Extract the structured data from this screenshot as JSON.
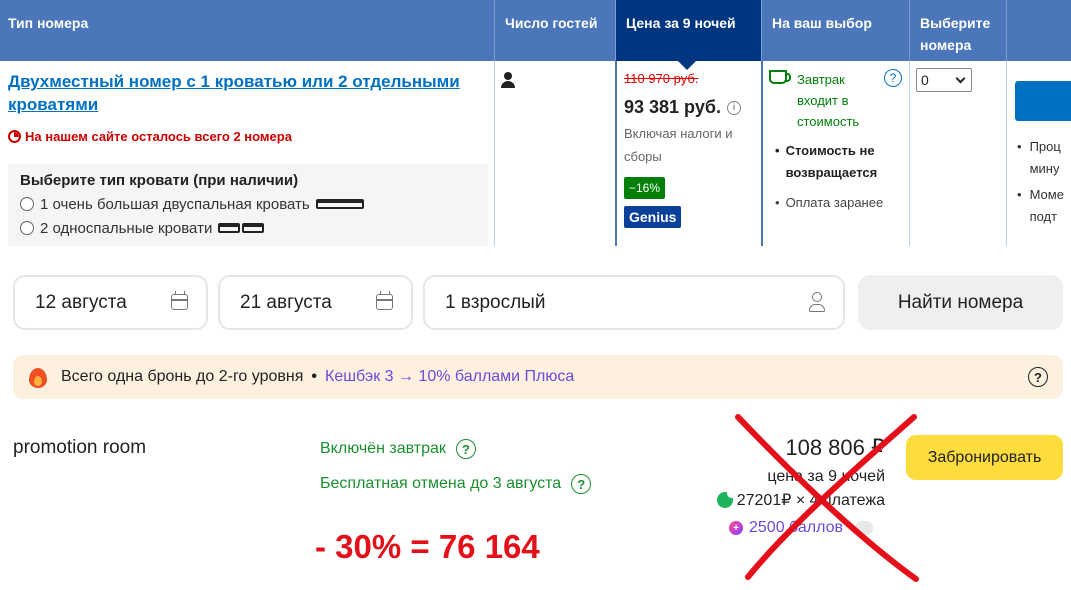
{
  "table": {
    "headers": {
      "room_type": "Тип номера",
      "guests": "Число гостей",
      "price": "Цена за 9 ночей",
      "your_choice": "На ваш выбор",
      "select": "Выберите номера"
    },
    "room": {
      "name": "Двухместный номер с 1 кроватью или 2 отдельными кроватями",
      "scarcity": "На нашем сайте осталось всего 2 номера",
      "bed_title": "Выберите тип кровати (при наличии)",
      "bed_options": [
        "1 очень большая двуспальная кровать",
        "2 односпальные кровати"
      ]
    },
    "price": {
      "old": "110 970 руб.",
      "new": "93 381 руб.",
      "tax_note": "Включая налоги и сборы",
      "discount": "−16%",
      "badge": "Genius"
    },
    "choice": {
      "breakfast": "Завтрак входит в стоимость",
      "non_refundable": "Стоимость не возвращается",
      "prepay": "Оплата заранее"
    },
    "select_value": "0",
    "right_items": [
      "Проц мину",
      "Моме подт"
    ]
  },
  "search": {
    "checkin": "12 августа",
    "checkout": "21 августа",
    "guests": "1 взрослый",
    "find_label": "Найти номера"
  },
  "banner": {
    "text": "Всего одна бронь до 2-го уровня",
    "dot": "•",
    "cashback": "Кешбэк 3 → 10% баллами Плюса",
    "help": "?"
  },
  "offer": {
    "title": "promotion room",
    "breakfast": "Включён завтрак",
    "cancellation": "Бесплатная отмена до 3 августа",
    "price": "108 806 ₽",
    "price_note": "цена за 9 ночей",
    "split": "27201₽ × 4 платежа",
    "points": "2500 баллов",
    "book_label": "Забронировать",
    "annotation": "- 30% = 76 164"
  },
  "colors": {
    "header_blue": "#4b76b9",
    "header_active": "#003580",
    "link_blue": "#0071c2",
    "green": "#1a8f2f",
    "annotation_red": "#e3101a",
    "book_yellow": "#fddc3e"
  }
}
